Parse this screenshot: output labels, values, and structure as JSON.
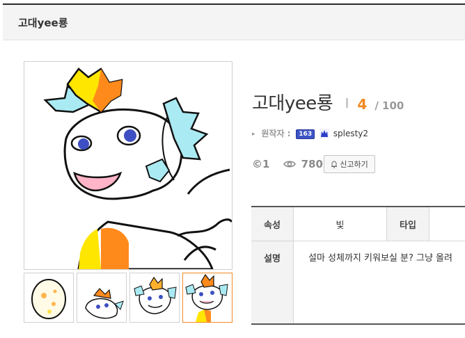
{
  "header": {
    "title": "고대yee룡"
  },
  "creature": {
    "name": "고대yee룡",
    "level": "4",
    "level_max": "/ 100"
  },
  "author": {
    "label": "원작자 :",
    "level_badge": "163",
    "name": "splesty2"
  },
  "stats": {
    "copyright": "©1",
    "views": "780",
    "report_label": "신고하기"
  },
  "info_table": {
    "attribute_label": "속성",
    "attribute_value": "빛",
    "type_label": "타입",
    "type_value": "",
    "description_label": "설명",
    "description": "설마 성체까지 키워보실 분? 그냥 올려"
  },
  "thumbnails": [
    {
      "label": "egg",
      "selected": false
    },
    {
      "label": "baby",
      "selected": false
    },
    {
      "label": "teen",
      "selected": false
    },
    {
      "label": "adult",
      "selected": true
    }
  ],
  "colors": {
    "accent": "#f08a24",
    "badge": "#3e55c6"
  }
}
